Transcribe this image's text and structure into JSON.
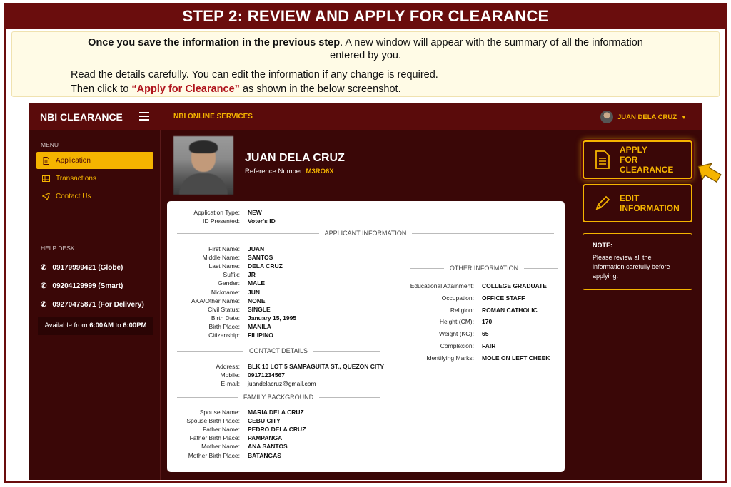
{
  "banner": {
    "title": "STEP 2: REVIEW AND APPLY FOR CLEARANCE"
  },
  "intro": {
    "line1_bold": "Once you save the information in the previous step",
    "line1_rest": ". A new window will appear with the summary of all the information",
    "line1b": "entered by you.",
    "line2": "Read the details carefully. You can edit the information if any change is required.",
    "line3_pre": "Then click to ",
    "line3_highlight": "“Apply for Clearance”",
    "line3_post": " as shown in the below screenshot."
  },
  "app": {
    "brand": "NBI CLEARANCE",
    "service_title": "NBI ONLINE SERVICES",
    "user_name": "JUAN DELA CRUZ",
    "accent_color": "#f5b400",
    "bg_color": "#3a0707"
  },
  "sidebar": {
    "menu_label": "MENU",
    "items": [
      {
        "label": "Application",
        "icon": "document-icon",
        "active": true
      },
      {
        "label": "Transactions",
        "icon": "table-icon",
        "active": false
      },
      {
        "label": "Contact Us",
        "icon": "send-icon",
        "active": false
      }
    ],
    "help_label": "HELP DESK",
    "phones": [
      {
        "text": "09179999421 (Globe)"
      },
      {
        "text": "09204129999 (Smart)"
      },
      {
        "text": "09270475871 (For Delivery)"
      }
    ],
    "availability_pre": "Available from ",
    "availability_start": "6:00AM",
    "availability_mid": " to ",
    "availability_end": "6:00PM"
  },
  "profile": {
    "name": "JUAN DELA CRUZ",
    "ref_label": "Reference Number: ",
    "ref_value": "M3RO6X"
  },
  "summary": {
    "top": [
      {
        "k": "Application Type:",
        "v": "NEW"
      },
      {
        "k": "ID Presented:",
        "v": "Voter's ID"
      }
    ],
    "applicant_title": "APPLICANT INFORMATION",
    "applicant": [
      {
        "k": "First Name:",
        "v": "JUAN"
      },
      {
        "k": "Middle Name:",
        "v": "SANTOS"
      },
      {
        "k": "Last Name:",
        "v": "DELA CRUZ"
      },
      {
        "k": "Suffix:",
        "v": "JR"
      },
      {
        "k": "Gender:",
        "v": "MALE"
      },
      {
        "k": "Nickname:",
        "v": "JUN"
      },
      {
        "k": "AKA/Other Name:",
        "v": "NONE"
      },
      {
        "k": "Civil Status:",
        "v": "SINGLE"
      },
      {
        "k": "Birth Date:",
        "v": "January 15, 1995"
      },
      {
        "k": "Birth Place:",
        "v": "MANILA"
      },
      {
        "k": "Citizenship:",
        "v": "FILIPINO"
      }
    ],
    "other_title": "OTHER INFORMATION",
    "other": [
      {
        "k": "Educational Attainment:",
        "v": "COLLEGE GRADUATE"
      },
      {
        "k": "Occupation:",
        "v": "OFFICE STAFF"
      },
      {
        "k": "Religion:",
        "v": "ROMAN CATHOLIC"
      },
      {
        "k": "Height (CM):",
        "v": "170"
      },
      {
        "k": "Weight (KG):",
        "v": "65"
      },
      {
        "k": "Complexion:",
        "v": "FAIR"
      },
      {
        "k": "Identifying Marks:",
        "v": "MOLE ON LEFT CHEEK"
      }
    ],
    "contact_title": "CONTACT DETAILS",
    "contact": [
      {
        "k": "Address:",
        "v": "BLK 10 LOT 5 SAMPAGUITA ST., QUEZON CITY"
      },
      {
        "k": "Mobile:",
        "v": "09171234567"
      },
      {
        "k": "E-mail:",
        "v": "juandelacruz@gmail.com"
      }
    ],
    "family_title": "FAMILY BACKGROUND",
    "family": [
      {
        "k": "Spouse Name:",
        "v": "MARIA DELA CRUZ"
      },
      {
        "k": "Spouse Birth Place:",
        "v": "CEBU CITY"
      },
      {
        "k": "Father Name:",
        "v": "PEDRO DELA CRUZ"
      },
      {
        "k": "Father Birth Place:",
        "v": "PAMPANGA"
      },
      {
        "k": "Mother Name:",
        "v": "ANA SANTOS"
      },
      {
        "k": "Mother Birth Place:",
        "v": "BATANGAS"
      }
    ]
  },
  "actions": {
    "apply_line1": "APPLY",
    "apply_line2": "FOR CLEARANCE",
    "edit_line1": "EDIT",
    "edit_line2": "INFORMATION"
  },
  "note": {
    "title": "NOTE:",
    "body": "Please review all the information carefully before applying."
  }
}
